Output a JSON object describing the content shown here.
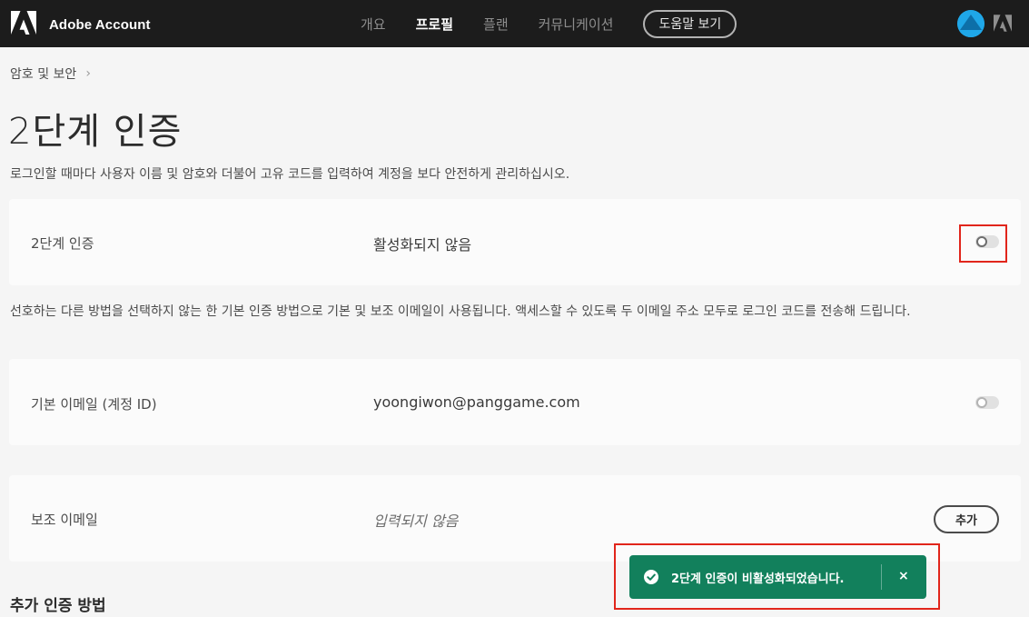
{
  "header": {
    "brand_name": "Adobe Account",
    "nav": [
      {
        "label": "개요",
        "active": false
      },
      {
        "label": "프로필",
        "active": true
      },
      {
        "label": "플랜",
        "active": false
      },
      {
        "label": "커뮤니케이션",
        "active": false
      }
    ],
    "help_label": "도움말 보기",
    "icons": {
      "brand": "adobe-logo-icon",
      "avatar": "user-avatar",
      "app_logo": "adobe-logo-icon"
    }
  },
  "breadcrumb": {
    "label": "암호 및 보안",
    "separator": "›"
  },
  "page": {
    "title": "2단계 인증",
    "description": "로그인할 때마다 사용자 이름 및 암호와 더불어 고유 코드를 입력하여 계정을 보다 안전하게 관리하십시오."
  },
  "two_step": {
    "label": "2단계 인증",
    "status": "활성화되지 않음",
    "enabled": false
  },
  "notice": "선호하는 다른 방법을 선택하지 않는 한 기본 인증 방법으로 기본 및 보조 이메일이 사용됩니다. 액세스할 수 있도록 두 이메일 주소 모두로 로그인 코드를 전송해 드립니다.",
  "primary_email": {
    "label": "기본 이메일 (계정 ID)",
    "value": "yoongiwon@panggame.com",
    "enabled": false
  },
  "secondary_email": {
    "label": "보조 이메일",
    "value": "입력되지 않음",
    "add_label": "추가"
  },
  "additional_methods": {
    "heading": "추가 인증 방법"
  },
  "toast": {
    "message": "2단계 인증이 비활성화되었습니다.",
    "close": "×",
    "color": "#12805c"
  },
  "colors": {
    "header_bg": "#1c1c1c",
    "accent": "#1fa7e8",
    "highlight": "#e1251b"
  }
}
